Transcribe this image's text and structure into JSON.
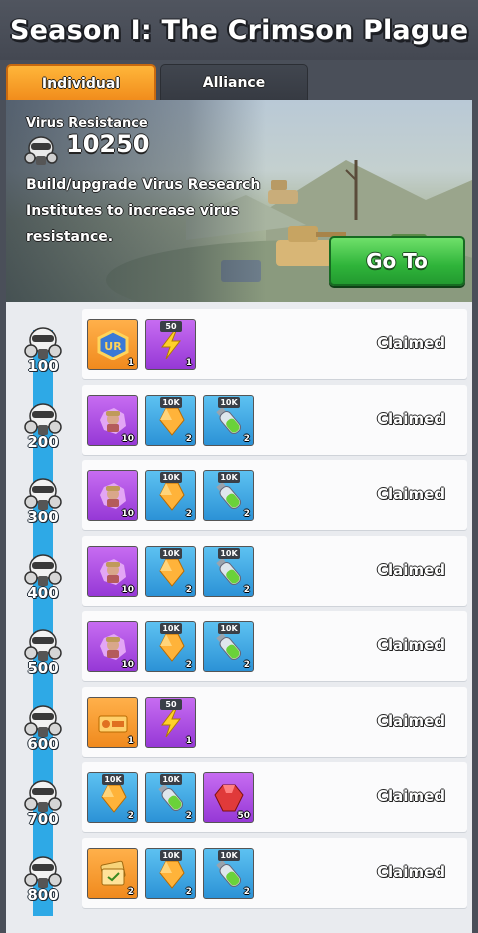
{
  "title": "Season I: The Crimson Plague",
  "tabs": [
    {
      "label": "Individual",
      "active": true
    },
    {
      "label": "Alliance",
      "active": false
    }
  ],
  "banner": {
    "resistance_label": "Virus Resistance",
    "resistance_value": "10250",
    "description": "Build/upgrade Virus Research Institutes to increase virus resistance.",
    "goto_label": "Go To"
  },
  "colors": {
    "active_tab": "#f59a24",
    "go_button": "#2fb43a",
    "progress": "#2ea9e6"
  },
  "tiers": [
    {
      "milestone": "100",
      "status": "Claimed",
      "rewards": [
        {
          "icon": "ur-badge-icon",
          "color": "orange",
          "tag": "",
          "qty": "1"
        },
        {
          "icon": "lightning-icon",
          "color": "purple",
          "tag": "50",
          "qty": "1"
        }
      ]
    },
    {
      "milestone": "200",
      "status": "Claimed",
      "rewards": [
        {
          "icon": "hero-shard-icon",
          "color": "purple",
          "tag": "",
          "qty": "10"
        },
        {
          "icon": "crystal-icon",
          "color": "blue",
          "tag": "10K",
          "qty": "2"
        },
        {
          "icon": "vial-icon",
          "color": "blue",
          "tag": "10K",
          "qty": "2"
        }
      ]
    },
    {
      "milestone": "300",
      "status": "Claimed",
      "rewards": [
        {
          "icon": "hero-shard-icon",
          "color": "purple",
          "tag": "",
          "qty": "10"
        },
        {
          "icon": "crystal-icon",
          "color": "blue",
          "tag": "10K",
          "qty": "2"
        },
        {
          "icon": "vial-icon",
          "color": "blue",
          "tag": "10K",
          "qty": "2"
        }
      ]
    },
    {
      "milestone": "400",
      "status": "Claimed",
      "rewards": [
        {
          "icon": "hero-shard-icon",
          "color": "purple",
          "tag": "",
          "qty": "10"
        },
        {
          "icon": "crystal-icon",
          "color": "blue",
          "tag": "10K",
          "qty": "2"
        },
        {
          "icon": "vial-icon",
          "color": "blue",
          "tag": "10K",
          "qty": "2"
        }
      ]
    },
    {
      "milestone": "500",
      "status": "Claimed",
      "rewards": [
        {
          "icon": "hero-shard-icon",
          "color": "purple",
          "tag": "",
          "qty": "10"
        },
        {
          "icon": "crystal-icon",
          "color": "blue",
          "tag": "10K",
          "qty": "2"
        },
        {
          "icon": "vial-icon",
          "color": "blue",
          "tag": "10K",
          "qty": "2"
        }
      ]
    },
    {
      "milestone": "600",
      "status": "Claimed",
      "rewards": [
        {
          "icon": "ticket-icon",
          "color": "orange",
          "tag": "",
          "qty": "1"
        },
        {
          "icon": "lightning-icon",
          "color": "purple",
          "tag": "50",
          "qty": "1"
        }
      ]
    },
    {
      "milestone": "700",
      "status": "Claimed",
      "rewards": [
        {
          "icon": "crystal-icon",
          "color": "blue",
          "tag": "10K",
          "qty": "2"
        },
        {
          "icon": "vial-icon",
          "color": "blue",
          "tag": "10K",
          "qty": "2"
        },
        {
          "icon": "ruby-icon",
          "color": "purple",
          "tag": "",
          "qty": "50"
        }
      ]
    },
    {
      "milestone": "800",
      "status": "Claimed",
      "rewards": [
        {
          "icon": "card-stack-icon",
          "color": "orange",
          "tag": "",
          "qty": "2"
        },
        {
          "icon": "crystal-icon",
          "color": "blue",
          "tag": "10K",
          "qty": "2"
        },
        {
          "icon": "vial-icon",
          "color": "blue",
          "tag": "10K",
          "qty": "2"
        }
      ]
    }
  ]
}
